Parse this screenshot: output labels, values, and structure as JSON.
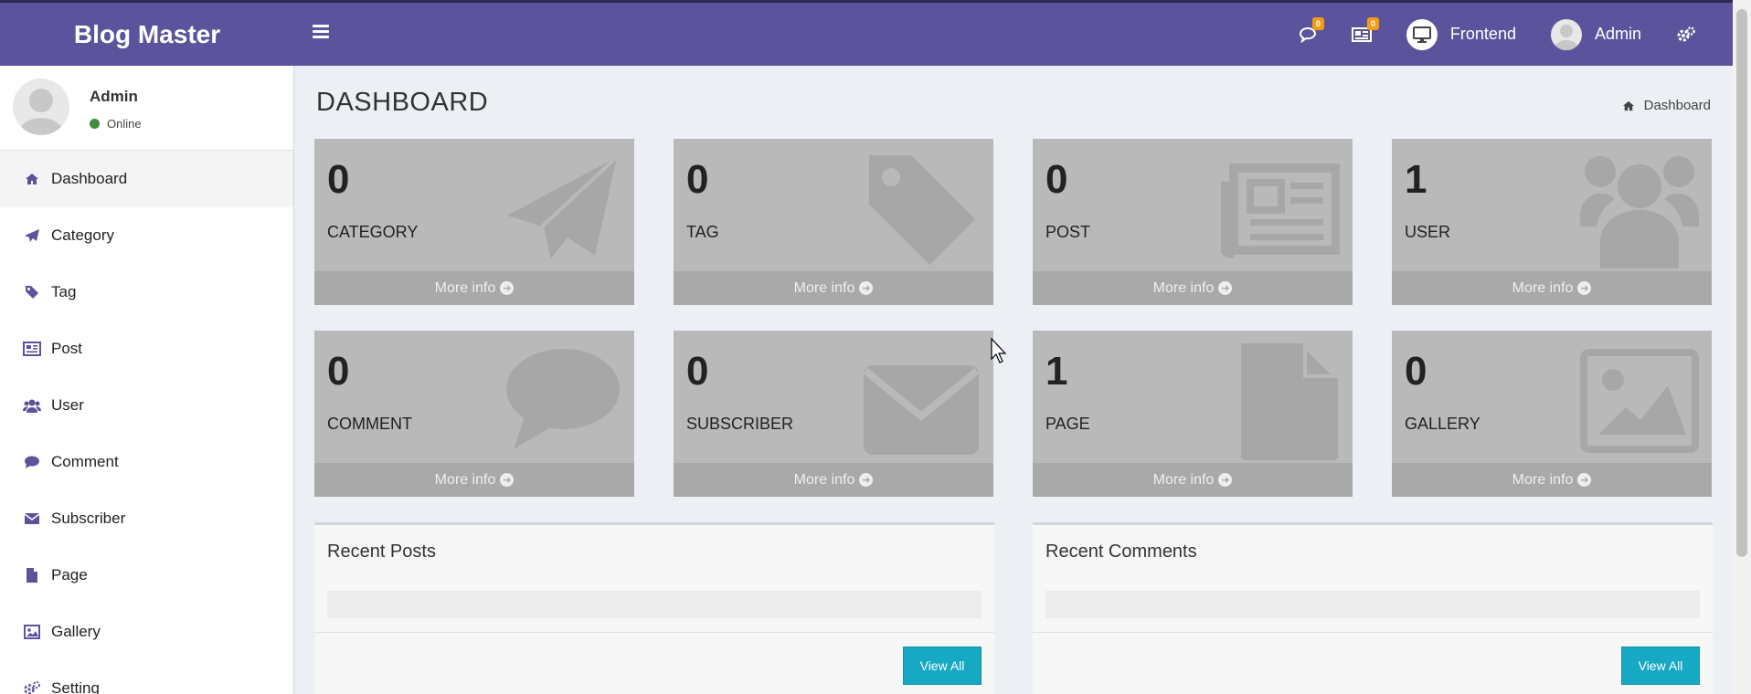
{
  "header": {
    "logo": "Blog Master",
    "comments_badge": "0",
    "messages_badge": "0",
    "frontend_label": "Frontend",
    "user_label": "Admin"
  },
  "sidebar": {
    "user": {
      "name": "Admin",
      "status": "Online"
    },
    "items": [
      {
        "label": "Dashboard",
        "icon": "home-icon",
        "active": true
      },
      {
        "label": "Category",
        "icon": "paper-plane-icon"
      },
      {
        "label": "Tag",
        "icon": "tag-icon"
      },
      {
        "label": "Post",
        "icon": "newspaper-icon"
      },
      {
        "label": "User",
        "icon": "users-icon"
      },
      {
        "label": "Comment",
        "icon": "comment-icon"
      },
      {
        "label": "Subscriber",
        "icon": "envelope-icon"
      },
      {
        "label": "Page",
        "icon": "file-icon"
      },
      {
        "label": "Gallery",
        "icon": "image-icon"
      },
      {
        "label": "Setting",
        "icon": "cogs-icon"
      }
    ]
  },
  "page": {
    "title": "DASHBOARD",
    "breadcrumb": "Dashboard"
  },
  "stats": [
    {
      "value": "0",
      "label": "CATEGORY",
      "more": "More info",
      "icon": "paper-plane-icon"
    },
    {
      "value": "0",
      "label": "TAG",
      "more": "More info",
      "icon": "tag-icon"
    },
    {
      "value": "0",
      "label": "POST",
      "more": "More info",
      "icon": "newspaper-icon"
    },
    {
      "value": "1",
      "label": "USER",
      "more": "More info",
      "icon": "users-icon"
    },
    {
      "value": "0",
      "label": "COMMENT",
      "more": "More info",
      "icon": "comment-icon"
    },
    {
      "value": "0",
      "label": "SUBSCRIBER",
      "more": "More info",
      "icon": "envelope-icon"
    },
    {
      "value": "1",
      "label": "PAGE",
      "more": "More info",
      "icon": "file-icon"
    },
    {
      "value": "0",
      "label": "GALLERY",
      "more": "More info",
      "icon": "image-icon"
    }
  ],
  "panels": {
    "recent_posts": {
      "title": "Recent Posts",
      "button": "View All"
    },
    "recent_comments": {
      "title": "Recent Comments",
      "button": "View All"
    }
  },
  "colors": {
    "header": "#5b549c",
    "box": "#b9b9b9",
    "box_footer": "#a9a9a9",
    "accent_button": "#17a8c4",
    "online": "#3c8d3c",
    "badge": "#f39c12"
  }
}
